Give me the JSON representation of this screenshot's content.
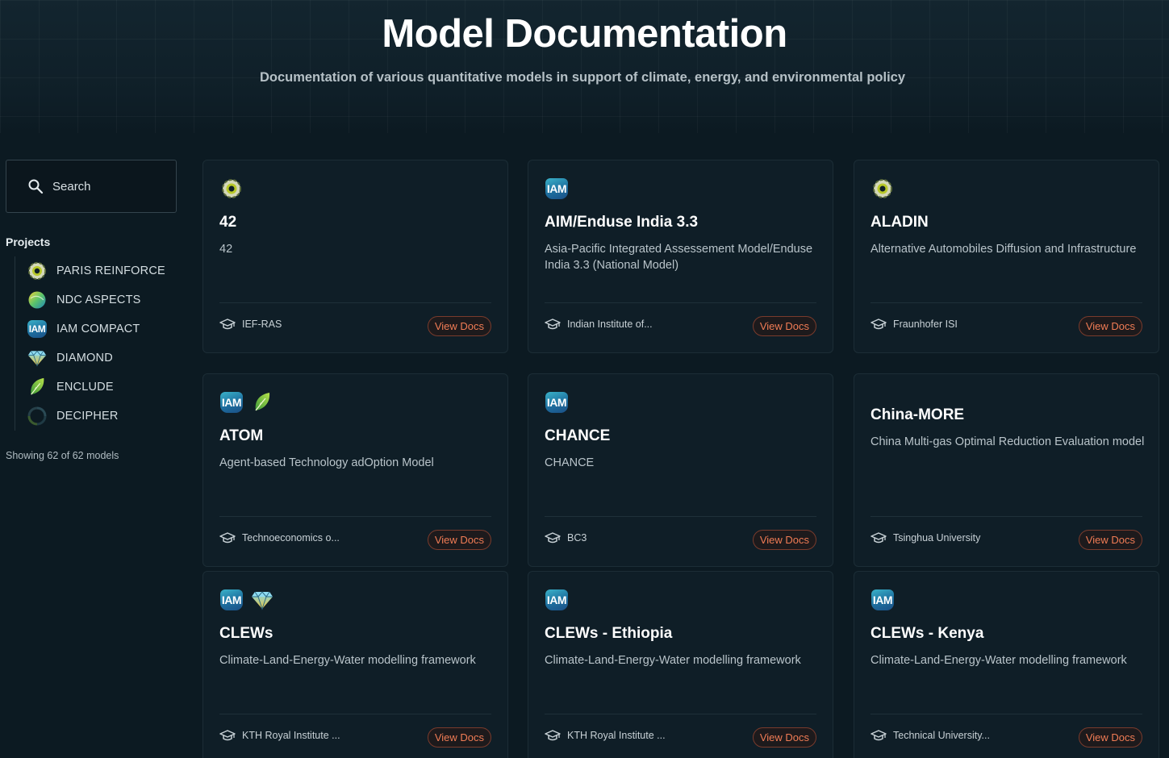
{
  "header": {
    "title": "Model Documentation",
    "subtitle": "Documentation of various quantitative models in support of climate, energy, and environmental policy"
  },
  "sidebar": {
    "search_placeholder": "Search",
    "projects_heading": "Projects",
    "projects": [
      {
        "label": "PARIS REINFORCE",
        "icon": "paris-reinforce-logo"
      },
      {
        "label": "NDC ASPECTS",
        "icon": "ndc-aspects-logo"
      },
      {
        "label": "IAM COMPACT",
        "icon": "iam-compact-logo"
      },
      {
        "label": "DIAMOND",
        "icon": "diamond-logo"
      },
      {
        "label": "ENCLUDE",
        "icon": "enclude-logo"
      },
      {
        "label": "DECIPHER",
        "icon": "decipher-logo"
      }
    ],
    "showing_text": "Showing 62 of 62 models"
  },
  "iam_label": "IAM",
  "view_docs_label": "View Docs",
  "models": [
    {
      "title": "42",
      "description": "42",
      "institution": "IEF-RAS",
      "project_icons": [
        "paris-reinforce-logo"
      ]
    },
    {
      "title": "AIM/Enduse India 3.3",
      "description": "Asia-Pacific Integrated Assessement Model/Enduse India 3.3 (National Model)",
      "institution": "Indian Institute of...",
      "project_icons": [
        "iam-compact-logo"
      ]
    },
    {
      "title": "ALADIN",
      "description": "Alternative Automobiles Diffusion and Infrastructure",
      "institution": "Fraunhofer ISI",
      "project_icons": [
        "paris-reinforce-logo"
      ]
    },
    {
      "title": "ATOM",
      "description": "Agent-based Technology adOption Model",
      "institution": "Technoeconomics o...",
      "project_icons": [
        "iam-compact-logo",
        "enclude-logo"
      ]
    },
    {
      "title": "CHANCE",
      "description": "CHANCE",
      "institution": "BC3",
      "project_icons": [
        "iam-compact-logo"
      ]
    },
    {
      "title": "China-MORE",
      "description": "China Multi-gas Optimal Reduction Evaluation model",
      "institution": "Tsinghua University",
      "project_icons": []
    },
    {
      "title": "CLEWs",
      "description": "Climate-Land-Energy-Water modelling framework",
      "institution": "KTH Royal Institute ...",
      "project_icons": [
        "iam-compact-logo",
        "diamond-logo"
      ]
    },
    {
      "title": "CLEWs - Ethiopia",
      "description": "Climate-Land-Energy-Water modelling framework",
      "institution": "KTH Royal Institute ...",
      "project_icons": [
        "iam-compact-logo"
      ]
    },
    {
      "title": "CLEWs - Kenya",
      "description": "Climate-Land-Energy-Water modelling framework",
      "institution": "Technical University...",
      "project_icons": [
        "iam-compact-logo"
      ]
    }
  ]
}
